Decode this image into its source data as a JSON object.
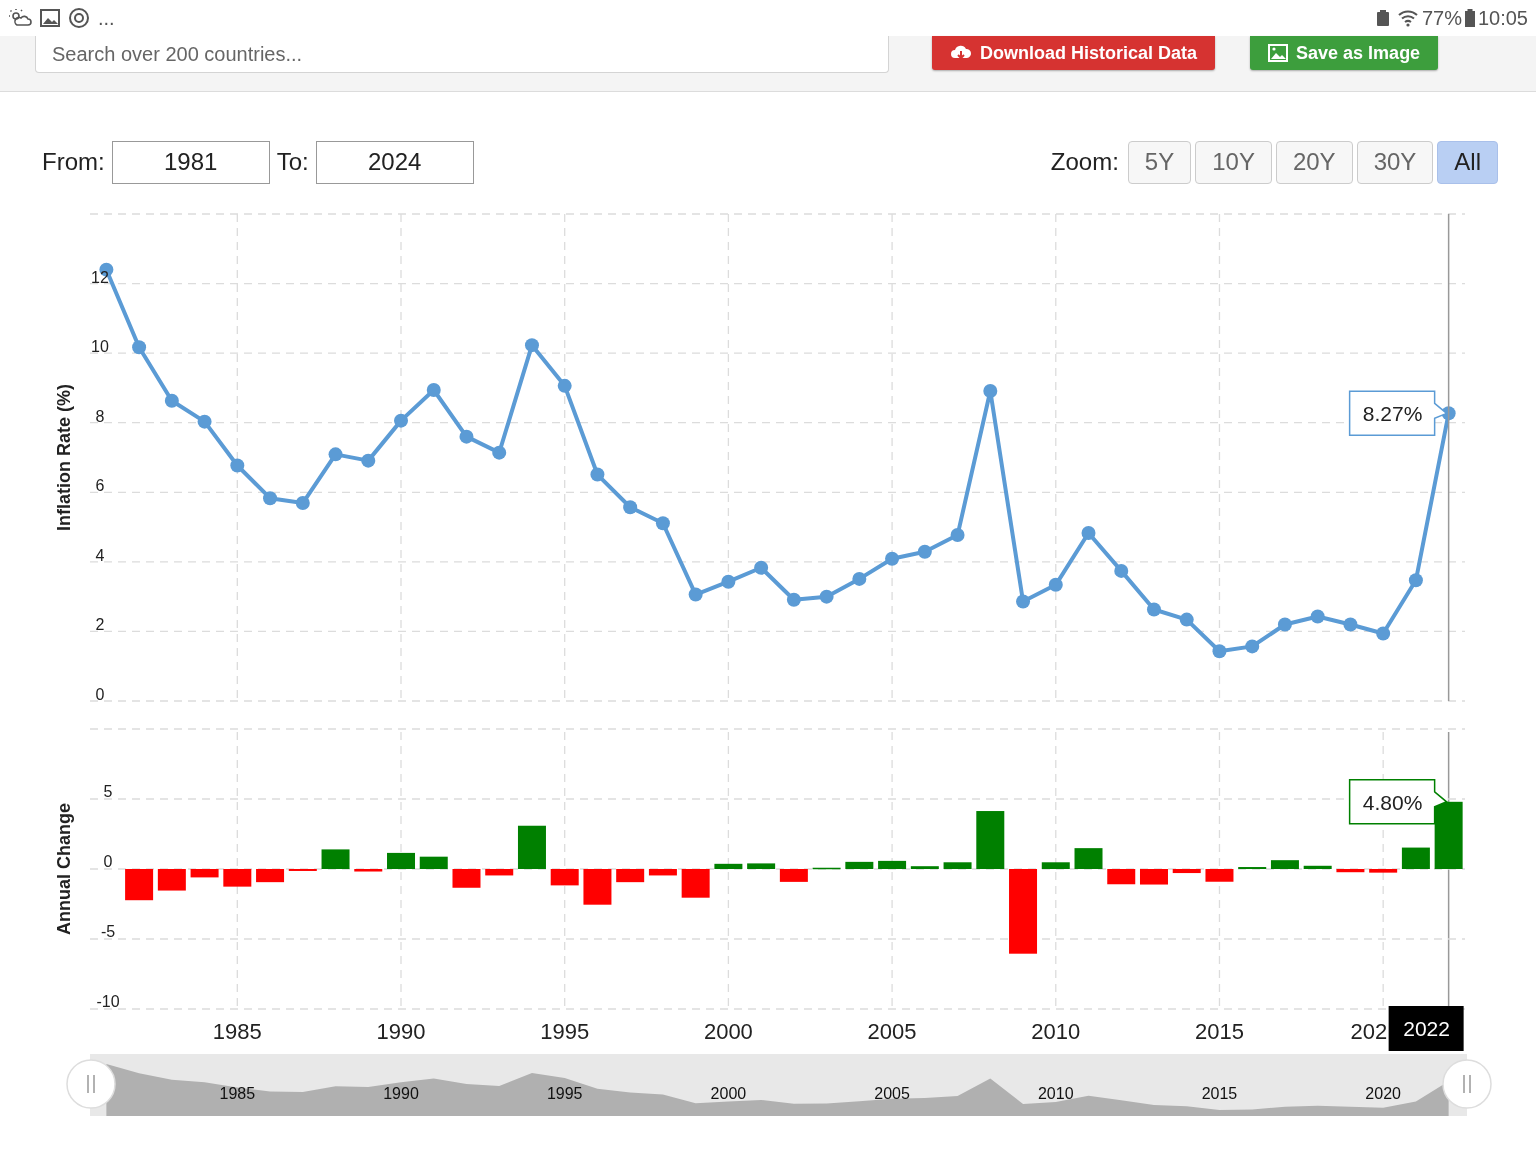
{
  "status_bar": {
    "more": "...",
    "battery": "77%",
    "time": "10:05"
  },
  "header": {
    "search": {
      "placeholder": "Search over 200 countries..."
    },
    "buttons": [
      {
        "label": "Download Historical Data",
        "kind": "download"
      },
      {
        "label": "Save as Image",
        "kind": "image"
      }
    ]
  },
  "range": {
    "from_label": "From:",
    "from": "1981",
    "to_label": "To:",
    "to": "2024",
    "zoom_label": "Zoom:",
    "zoom": [
      {
        "label": "5Y",
        "selected": false
      },
      {
        "label": "10Y",
        "selected": false
      },
      {
        "label": "20Y",
        "selected": false
      },
      {
        "label": "30Y",
        "selected": false
      },
      {
        "label": "All",
        "selected": true
      }
    ]
  },
  "charts": [
    {
      "chart_data": {
        "type": "line",
        "ylabel": "Inflation Rate (%)",
        "grid": true,
        "x": [
          1981,
          1982,
          1983,
          1984,
          1985,
          1986,
          1987,
          1988,
          1989,
          1990,
          1991,
          1992,
          1993,
          1994,
          1995,
          1996,
          1997,
          1998,
          1999,
          2000,
          2001,
          2002,
          2003,
          2004,
          2005,
          2006,
          2007,
          2008,
          2009,
          2010,
          2011,
          2012,
          2013,
          2014,
          2015,
          2016,
          2017,
          2018,
          2019,
          2020,
          2021,
          2022
        ],
        "xlim": [
          1980.5,
          2022.5
        ],
        "ylim": [
          0,
          14
        ],
        "yticks": [
          0,
          2,
          4,
          6,
          8,
          10,
          12
        ],
        "series": [
          {
            "color": "#5b9bd5",
            "marker": true,
            "values": [
              12.4,
              10.17,
              8.63,
              8.03,
              6.77,
              5.83,
              5.69,
              7.09,
              6.91,
              8.06,
              8.94,
              7.6,
              7.14,
              10.23,
              9.06,
              6.51,
              5.57,
              5.11,
              3.06,
              3.43,
              3.83,
              2.91,
              3.0,
              3.51,
              4.09,
              4.29,
              4.77,
              8.91,
              2.86,
              3.34,
              4.83,
              3.74,
              2.63,
              2.34,
              1.43,
              1.57,
              2.2,
              2.43,
              2.2,
              1.94,
              3.47,
              8.27
            ]
          }
        ],
        "annotations": [
          "8.27%"
        ]
      }
    },
    {
      "chart_data": {
        "type": "bar",
        "ylabel": "Annual Change",
        "grid": true,
        "x": [
          1982,
          1983,
          1984,
          1985,
          1986,
          1987,
          1988,
          1989,
          1990,
          1991,
          1992,
          1993,
          1994,
          1995,
          1996,
          1997,
          1998,
          1999,
          2000,
          2001,
          2002,
          2003,
          2004,
          2005,
          2006,
          2007,
          2008,
          2009,
          2010,
          2011,
          2012,
          2013,
          2014,
          2015,
          2016,
          2017,
          2018,
          2019,
          2020,
          2021,
          2022
        ],
        "xlim": [
          1980.5,
          2022.5
        ],
        "ylim": [
          -10,
          10
        ],
        "yticks": [
          -10,
          -5,
          0,
          5
        ],
        "xticks": [
          1985,
          1990,
          1995,
          2000,
          2005,
          2010,
          2015
        ],
        "series": [
          {
            "color": "#008000",
            "values": [
              null,
              null,
              null,
              null,
              null,
              null,
              1.4,
              null,
              1.15,
              0.88,
              null,
              null,
              3.09,
              null,
              null,
              null,
              null,
              null,
              0.37,
              0.4,
              null,
              0.09,
              0.51,
              0.58,
              0.2,
              0.48,
              4.14,
              null,
              0.48,
              1.49,
              null,
              null,
              null,
              null,
              0.14,
              0.63,
              0.23,
              null,
              null,
              1.53,
              4.8
            ]
          },
          {
            "color": "#ff0000",
            "values": [
              -2.23,
              -1.54,
              -0.6,
              -1.26,
              -0.94,
              -0.14,
              null,
              -0.18,
              null,
              null,
              -1.34,
              -0.46,
              null,
              -1.17,
              -2.55,
              -0.94,
              -0.46,
              -2.05,
              null,
              null,
              -0.92,
              null,
              null,
              null,
              null,
              null,
              null,
              -6.05,
              null,
              null,
              -1.09,
              -1.11,
              -0.29,
              -0.91,
              null,
              null,
              null,
              -0.23,
              -0.26,
              null,
              null
            ]
          }
        ],
        "annotations": [
          "4.80%"
        ]
      },
      "cut_tick_label": "202"
    }
  ],
  "crosshair": {
    "label": "2022"
  },
  "navigator": {
    "labels": [
      "1985",
      "1990",
      "1995",
      "2000",
      "2005",
      "2010",
      "2015",
      "2020"
    ]
  }
}
